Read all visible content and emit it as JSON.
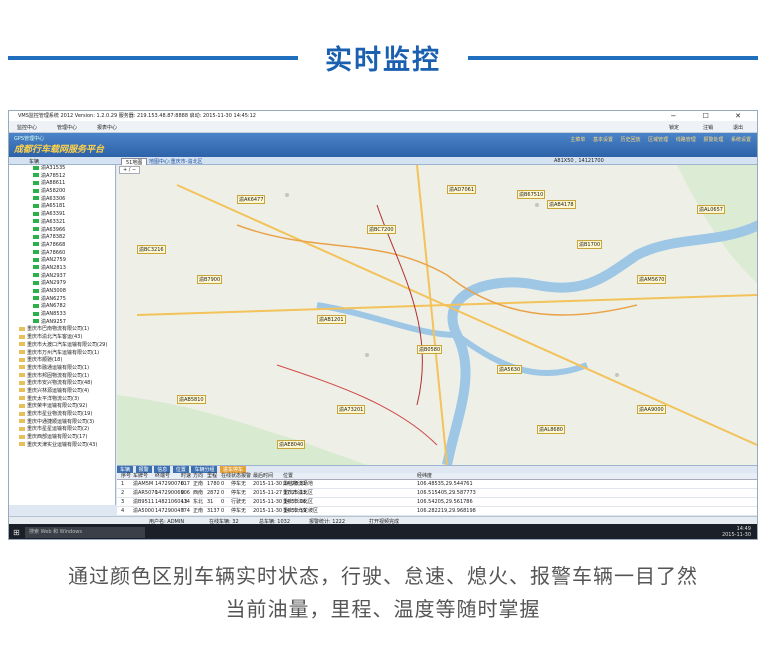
{
  "banner": {
    "title": "实时监控"
  },
  "window": {
    "title": "VMS监控管理系统 2012  Version: 1.2.0.29  服务器: 219.153.48.87:8888  启动: 2015-11-30 14:45:12"
  },
  "menu": [
    "监控中心",
    "管理中心",
    "报表中心"
  ],
  "menu_right": [
    "锁定",
    "注销",
    "退出"
  ],
  "app": {
    "sub": "GPS管理中心",
    "logo": "成都行车载网服务平台",
    "tabs": [
      "主菜单",
      "基本设置",
      "历史回放",
      "区域管理",
      "线路管理",
      "报警处理",
      "系统设置"
    ]
  },
  "sub": {
    "tree_label": "车辆",
    "map_select": "51地图",
    "map_center": "地图中心:重庆市-渝北区",
    "coord": "A81X50 , 14121700"
  },
  "tree": {
    "plates": [
      "渝A31535",
      "渝A78512",
      "渝A88611",
      "渝A58200",
      "渝A63306",
      "渝A65181",
      "渝A63391",
      "渝A63321",
      "渝A63966",
      "渝A78382",
      "渝A78668",
      "渝A78660",
      "渝AN2759",
      "渝AN2813",
      "渝AN2937",
      "渝AN2979",
      "渝AN3008",
      "渝AN6275",
      "渝AN6782",
      "渝AN8533",
      "渝AN9257"
    ],
    "companies": [
      "重庆市巴南物流有限公司(1)",
      "重庆市渝北汽车客运(43)",
      "重庆市大渡口汽车运输有限公司(29)",
      "重庆市万州汽车运输有限公司(1)",
      "重庆市顺驰(18)",
      "重庆市融通运输有限公司(1)",
      "重庆市邦固物流有限公司(1)",
      "重庆市安兴物流有限公司(48)",
      "重庆兴林源运输有限公司(4)",
      "重庆太平洋物流公司(3)",
      "重庆荣丰运输有限公司(92)",
      "重庆市星业物流有限公司(19)",
      "重庆中通捷顺运输有限公司(3)",
      "重庆市星星运输有限公司(2)",
      "重庆西部运输有限公司(17)",
      "重庆天津实业运输有限公司(43)"
    ]
  },
  "map": {
    "labels": [
      "渝AK6477",
      "渝AD7061",
      "渝B67510",
      "渝AB4178",
      "渝AL0657",
      "渝BC3216",
      "渝BC7200",
      "渝B1700",
      "渝AM5670",
      "渝B7900",
      "渝AB1201",
      "渝B0580",
      "渝A5630",
      "渝AB5810",
      "渝A73201",
      "渝AL8680",
      "渝AE8040",
      "渝AA9000"
    ]
  },
  "bottom_tabs": [
    "车辆",
    "报警",
    "信息",
    "位置",
    "车辆分组",
    "进车停车"
  ],
  "grid": {
    "headers": [
      "序号",
      "车牌号",
      "终端号",
      "时速",
      "方向",
      "里程",
      "在线",
      "状态",
      "报警",
      "最后时间",
      "位置",
      "经纬度"
    ],
    "rows": [
      [
        "1",
        "渝AM5M",
        "14729007617",
        "0",
        "正南",
        "1780",
        "0",
        "停车",
        "无",
        "2015-11-30 14:28:31",
        "鼎佳物流场地",
        "106.48535,29.544761"
      ],
      [
        "2",
        "渝AR5070",
        "14729006906",
        "0",
        "西南",
        "2872",
        "0",
        "停车",
        "无",
        "2015-11-27 17:25:13",
        "重庆市渝北区",
        "106.515405,29.587773"
      ],
      [
        "3",
        "渝B9511",
        "14821060414",
        "13",
        "东北",
        "31",
        "0",
        "行驶",
        "无",
        "2015-11-30 14:53:06",
        "重庆市江北区",
        "106.54205,29.561786"
      ],
      [
        "4",
        "渝A5000",
        "14729004774",
        "0",
        "正南",
        "3137",
        "0",
        "停车",
        "无",
        "2015-11-30 14:52:39",
        "重庆市九龙坡区",
        "106.282219,29.968198"
      ]
    ]
  },
  "status": {
    "user": "用户名:  ADMIN",
    "online": "在线车辆: 32",
    "total": "总车辆: 1032",
    "alarm": "报警统计: 1222",
    "msg": "打开视频完成"
  },
  "taskbar": {
    "search": "搜索 Web 和 Windows",
    "time": "14:49",
    "date": "2015-11-30"
  },
  "captions": [
    "通过颜色区别车辆实时状态，行驶、怠速、熄火、报警车辆一目了然",
    "当前油量，里程、温度等随时掌握"
  ],
  "colors": {
    "brand": "#1a5fb0",
    "accent": "#ffd14a"
  }
}
